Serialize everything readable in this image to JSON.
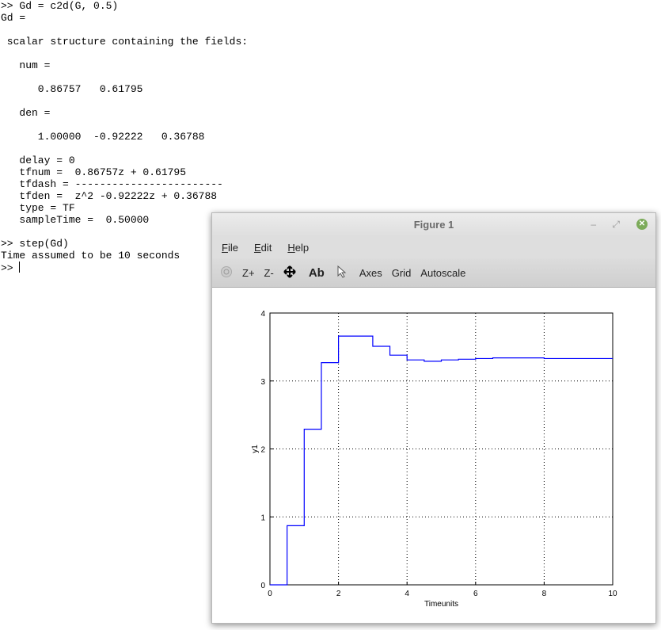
{
  "terminal": {
    "lines": [
      ">> Gd = c2d(G, 0.5)",
      "Gd =",
      "",
      " scalar structure containing the fields:",
      "",
      "   num =",
      "",
      "      0.86757   0.61795",
      "",
      "   den =",
      "",
      "      1.00000  -0.92222   0.36788",
      "",
      "   delay = 0",
      "   tfnum =  0.86757z + 0.61795",
      "   tfdash = ------------------------",
      "   tfden =  z^2 -0.92222z + 0.36788",
      "   type = TF",
      "   sampleTime =  0.50000",
      "",
      ">> step(Gd)",
      "Time assumed to be 10 seconds"
    ],
    "prompt": ">> "
  },
  "window": {
    "title": "Figure 1",
    "minimize": "–",
    "restore": "⤢",
    "close": "✕"
  },
  "menu": [
    {
      "first": "F",
      "rest": "ile"
    },
    {
      "first": "E",
      "rest": "dit"
    },
    {
      "first": "H",
      "rest": "elp"
    }
  ],
  "toolbar": {
    "z_in": "Z+",
    "z_out": "Z-",
    "text_icon": "Ab",
    "axes": "Axes",
    "grid": "Grid",
    "autoscale": "Autoscale"
  },
  "chart_data": {
    "type": "line",
    "step": true,
    "xlabel": "Timeunits",
    "ylabel": "y1",
    "xlim": [
      0,
      10
    ],
    "ylim": [
      0,
      4
    ],
    "grid": true,
    "line_color": "#0000ff",
    "xticks": [
      "0",
      "2",
      "4",
      "6",
      "8",
      "10"
    ],
    "yticks": [
      "0",
      "1",
      "2",
      "3",
      "4"
    ],
    "x": [
      0,
      0.5,
      1,
      1.5,
      2,
      2.5,
      3,
      3.5,
      4,
      4.5,
      5,
      5.5,
      6,
      6.5,
      7,
      7.5,
      8,
      8.5,
      9,
      9.5,
      10
    ],
    "y": [
      0,
      0.87,
      2.29,
      3.27,
      3.66,
      3.66,
      3.51,
      3.38,
      3.31,
      3.29,
      3.31,
      3.32,
      3.33,
      3.34,
      3.34,
      3.34,
      3.33,
      3.33,
      3.33,
      3.33,
      3.33
    ]
  }
}
